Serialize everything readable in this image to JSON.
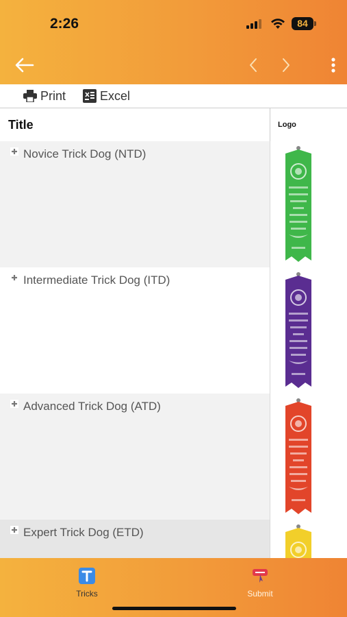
{
  "status_bar": {
    "time": "2:26",
    "battery": "84"
  },
  "toolbar": {
    "print_label": "Print",
    "excel_label": "Excel"
  },
  "table": {
    "columns": [
      "Title",
      "Logo"
    ],
    "rows": [
      {
        "title": "Novice Trick Dog (NTD)",
        "ribbon_color": "#3fb74a",
        "ribbon_level": "NOVICE"
      },
      {
        "title": "Intermediate Trick Dog (ITD)",
        "ribbon_color": "#5a2d91",
        "ribbon_level": "INTERMEDIATE"
      },
      {
        "title": "Advanced Trick Dog (ATD)",
        "ribbon_color": "#e2452a",
        "ribbon_level": "ADVANCED"
      },
      {
        "title": "Expert Trick Dog (ETD)",
        "ribbon_color": "#f2cf2a",
        "ribbon_level": ""
      }
    ]
  },
  "tabbar": {
    "tabs": [
      {
        "label": "Tricks",
        "icon": "tricks-icon",
        "active": true
      },
      {
        "label": "Submit",
        "icon": "submit-icon",
        "active": false
      }
    ]
  },
  "colors": {
    "accent_start": "#f4b23e",
    "accent_end": "#ef8434",
    "tricks_tab_icon": "#3b8be6"
  }
}
